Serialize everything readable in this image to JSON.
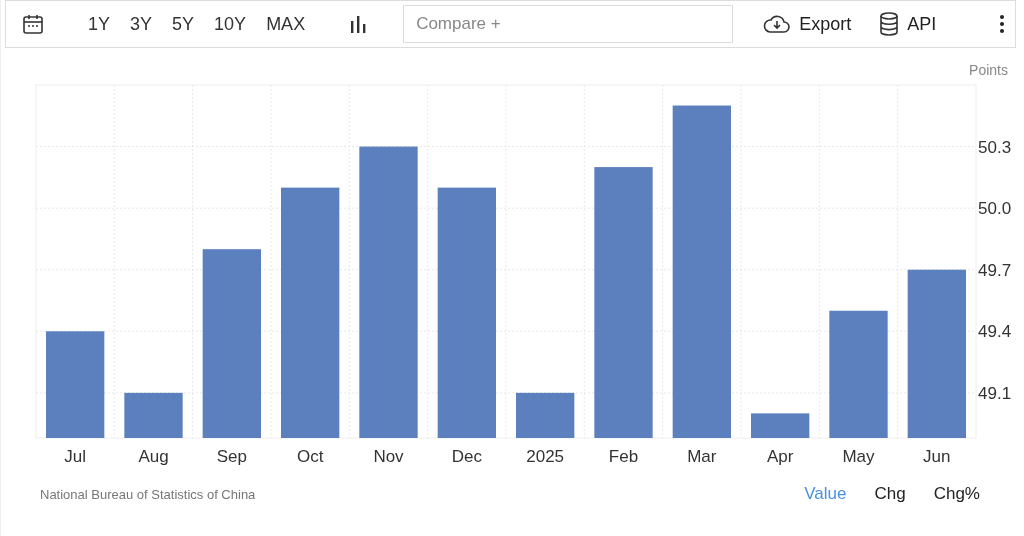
{
  "toolbar": {
    "ranges": [
      "1Y",
      "3Y",
      "5Y",
      "10Y",
      "MAX"
    ],
    "compare": {
      "placeholder": "Compare +"
    },
    "export": "Export",
    "api": "API"
  },
  "chart": {
    "unit": "Points",
    "chart_data": {
      "type": "bar",
      "categories": [
        "Jul",
        "Aug",
        "Sep",
        "Oct",
        "Nov",
        "Dec",
        "2025",
        "Feb",
        "Mar",
        "Apr",
        "May",
        "Jun"
      ],
      "values": [
        49.4,
        49.1,
        49.8,
        50.1,
        50.3,
        50.1,
        49.1,
        50.2,
        50.5,
        49.0,
        49.5,
        49.7
      ],
      "ylim": [
        48.88,
        50.6
      ],
      "grid": true,
      "yticks": [
        {
          "value": 49.1,
          "label": "49.1"
        },
        {
          "value": 49.4,
          "label": "49.4"
        },
        {
          "value": 49.7,
          "label": "49.7"
        },
        {
          "value": 50,
          "label": "50.0"
        },
        {
          "value": 50.3,
          "label": "50.3"
        }
      ]
    }
  },
  "footer": {
    "source": "National Bureau of Statistics of China",
    "views": [
      {
        "label": "Value",
        "selected": true
      },
      {
        "label": "Chg",
        "selected": false
      },
      {
        "label": "Chg%",
        "selected": false
      }
    ]
  }
}
